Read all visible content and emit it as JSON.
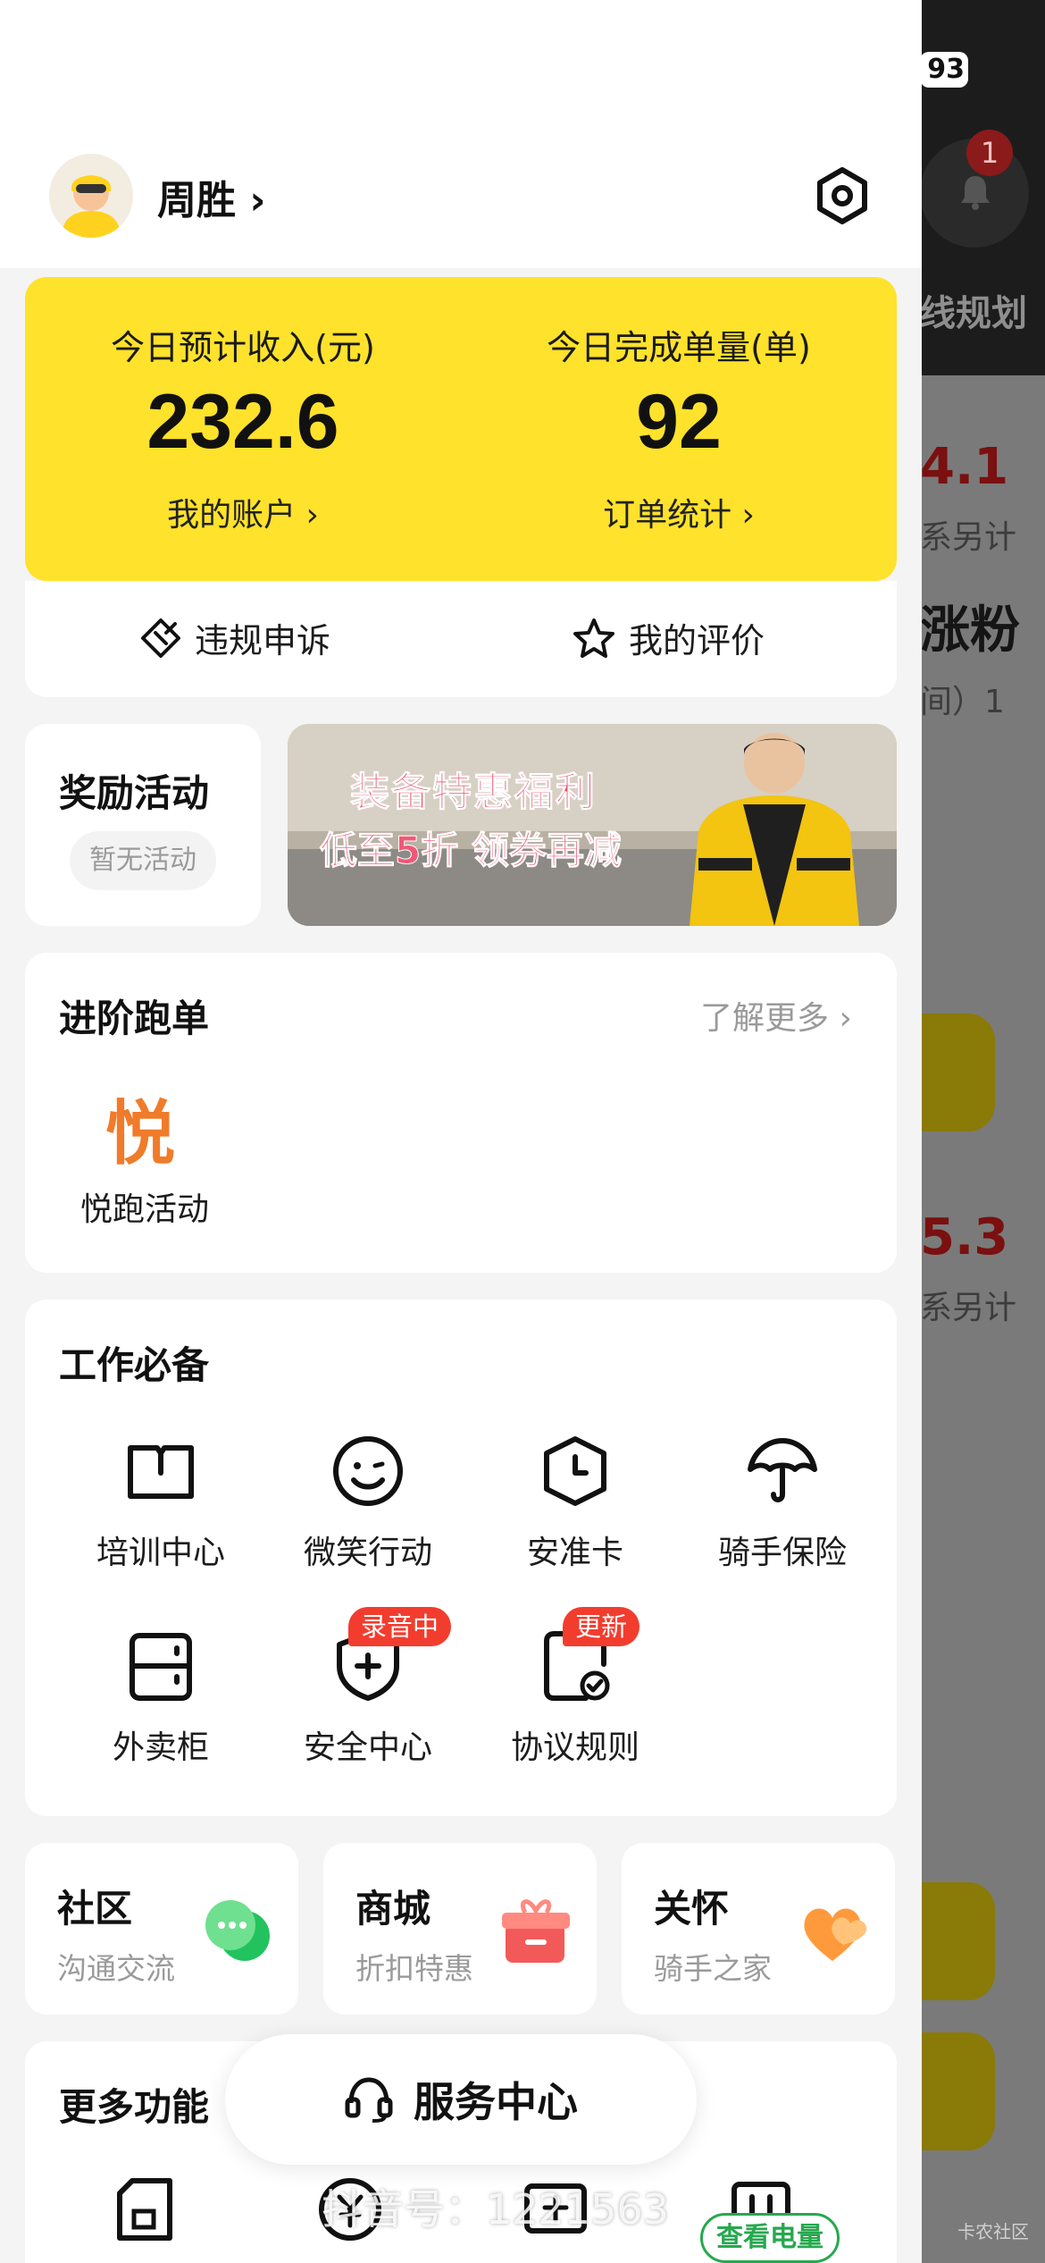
{
  "background_app": {
    "battery": "93",
    "notification_count": "1",
    "route_label": "线规划",
    "values": [
      "4.1",
      "5.3"
    ],
    "sub_label": "系另计",
    "heading": "涨粉",
    "heading_sub": "间）1",
    "corner_mark": "卡农社区"
  },
  "profile": {
    "name": "周胜",
    "chevron": "›"
  },
  "stats": {
    "income_label": "今日预计收入(元)",
    "income_value": "232.6",
    "income_link": "我的账户 ›",
    "orders_label": "今日完成单量(单)",
    "orders_value": "92",
    "orders_link": "订单统计 ›"
  },
  "quick": {
    "appeal": "违规申诉",
    "rating": "我的评价"
  },
  "reward": {
    "title": "奖励活动",
    "status": "暂无活动"
  },
  "banner": {
    "line1": "装备特惠福利",
    "line2": "低至5折 领券再减"
  },
  "advanced": {
    "title": "进阶跑单",
    "more": "了解更多 ›",
    "item_icon": "悦",
    "item_label": "悦跑活动"
  },
  "work": {
    "title": "工作必备",
    "items": [
      {
        "label": "培训中心",
        "icon": "book-icon"
      },
      {
        "label": "微笑行动",
        "icon": "smile-icon"
      },
      {
        "label": "安准卡",
        "icon": "clock-icon"
      },
      {
        "label": "骑手保险",
        "icon": "umbrella-icon"
      },
      {
        "label": "外卖柜",
        "icon": "locker-icon"
      },
      {
        "label": "安全中心",
        "icon": "shield-icon",
        "tag": "录音中"
      },
      {
        "label": "协议规则",
        "icon": "document-check-icon",
        "tag": "更新"
      }
    ]
  },
  "minis": [
    {
      "title": "社区",
      "sub": "沟通交流",
      "icon": "chat-icon"
    },
    {
      "title": "商城",
      "sub": "折扣特惠",
      "icon": "gift-icon"
    },
    {
      "title": "关怀",
      "sub": "骑手之家",
      "icon": "heart-icon"
    }
  ],
  "more": {
    "title": "更多功能"
  },
  "service": {
    "label": "服务中心"
  },
  "watermark": "抖音号：1221563",
  "charge": {
    "label": "查看电量"
  },
  "colors": {
    "brand_yellow": "#ffe22b",
    "tag_red": "#f23d2e",
    "accent_orange": "#f07b2a",
    "charge_green": "#27a84f"
  }
}
